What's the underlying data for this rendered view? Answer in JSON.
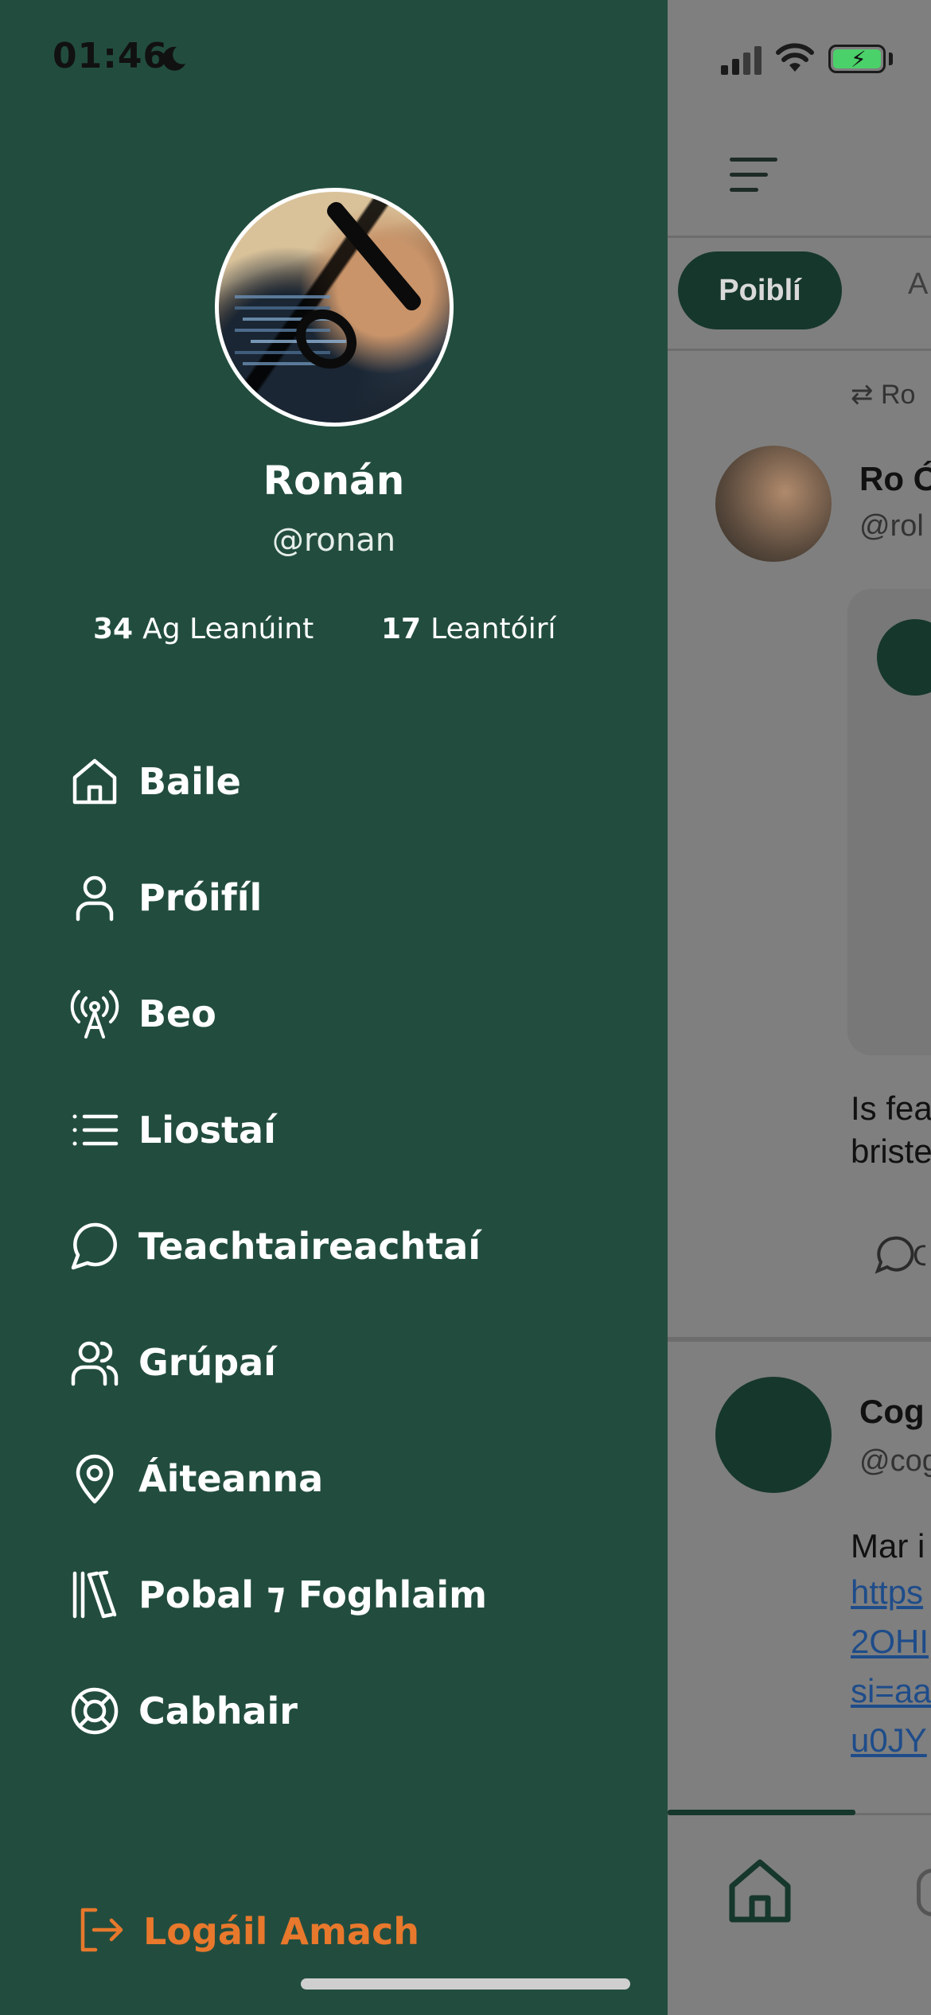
{
  "status_bar": {
    "time": "01:46"
  },
  "drawer": {
    "profile": {
      "name": "Ronán",
      "handle": "@ronan",
      "following_count": "34",
      "following_label": "Ag Leanúint",
      "followers_count": "17",
      "followers_label": "Leantóirí"
    },
    "menu": [
      {
        "label": "Baile",
        "icon": "home-icon"
      },
      {
        "label": "Próifíl",
        "icon": "user-icon"
      },
      {
        "label": "Beo",
        "icon": "broadcast-icon"
      },
      {
        "label": "Liostaí",
        "icon": "list-icon"
      },
      {
        "label": "Teachtaireachtaí",
        "icon": "chat-bubble-icon"
      },
      {
        "label": "Grúpaí",
        "icon": "users-icon"
      },
      {
        "label": "Áiteanna",
        "icon": "map-pin-icon"
      },
      {
        "label": "Pobal ⁊ Foghlaim",
        "icon": "library-icon"
      },
      {
        "label": "Cabhair",
        "icon": "lifebuoy-icon"
      }
    ],
    "logout_label": "Logáil Amach"
  },
  "background": {
    "tab_active": "Poiblí",
    "tab_next": "A",
    "post1": {
      "repost_label": "Ro",
      "name": "Ro Ó",
      "handle": "@rol",
      "text_lines": [
        "Is fea",
        "briste"
      ],
      "comment_count": "C"
    },
    "post2": {
      "name": "Cog",
      "handle": "@cog",
      "text": "Mar i",
      "link_lines": [
        "https",
        "2OHI",
        "si=aa",
        "u0JY"
      ]
    }
  },
  "colors": {
    "drawer_bg": "#224d3e",
    "accent_dark": "#16372c",
    "logout": "#e8782c",
    "battery": "#4bd16a"
  }
}
